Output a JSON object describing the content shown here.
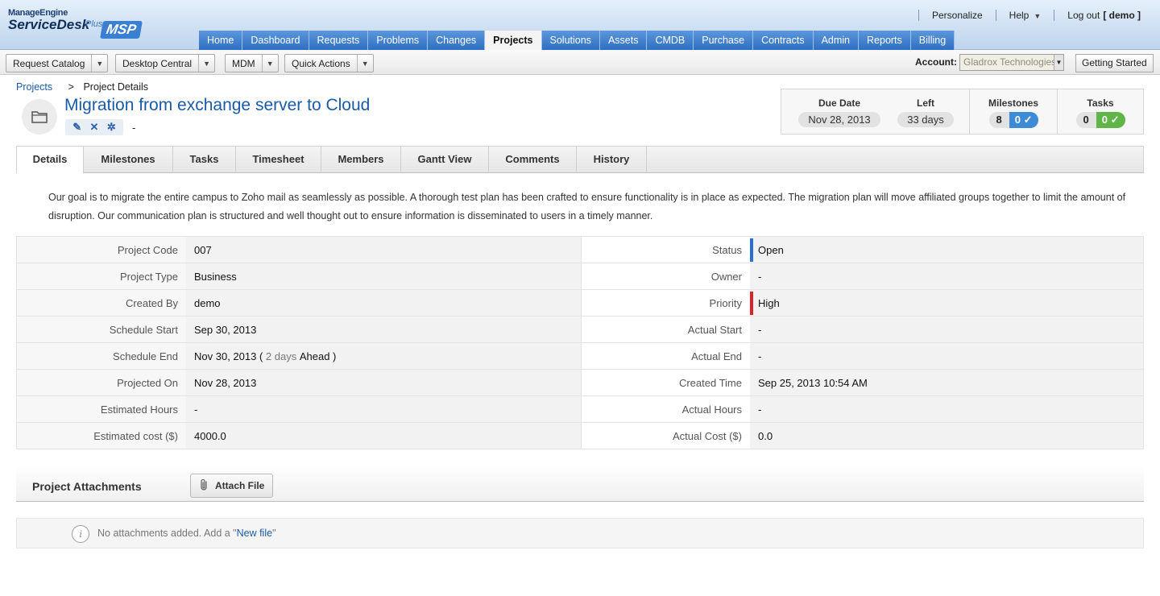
{
  "brand": {
    "line1": "ManageEngine",
    "line2": "ServiceDesk",
    "plus": "Plus",
    "msp": "MSP"
  },
  "toplinks": {
    "personalize": "Personalize",
    "help": "Help",
    "logout": "Log out",
    "user": "[ demo ]"
  },
  "nav": [
    "Home",
    "Dashboard",
    "Requests",
    "Problems",
    "Changes",
    "Projects",
    "Solutions",
    "Assets",
    "CMDB",
    "Purchase",
    "Contracts",
    "Admin",
    "Reports",
    "Billing"
  ],
  "nav_active": "Projects",
  "toolbar": {
    "request_catalog": "Request Catalog",
    "desktop_central": "Desktop Central",
    "mdm": "MDM",
    "quick_actions": "Quick Actions",
    "account_label": "Account:",
    "account_value": "Gladrox Technologies",
    "getting_started": "Getting Started"
  },
  "breadcrumb": {
    "root": "Projects",
    "sep": ">",
    "current": "Project Details"
  },
  "project": {
    "title": "Migration from exchange server to Cloud",
    "subline": "-"
  },
  "summary": {
    "due_label": "Due Date",
    "due_value": "Nov 28, 2013",
    "left_label": "Left",
    "left_value": "33 days",
    "milestones_label": "Milestones",
    "milestones_total": "8",
    "milestones_done": "0",
    "tasks_label": "Tasks",
    "tasks_total": "0",
    "tasks_done": "0",
    "colors": {
      "milestones_badge": "#3d8bd6",
      "tasks_badge": "#5fb548"
    }
  },
  "tabs": [
    "Details",
    "Milestones",
    "Tasks",
    "Timesheet",
    "Members",
    "Gantt View",
    "Comments",
    "History"
  ],
  "description": "Our goal is to migrate the entire campus to Zoho mail as seamlessly as possible. A thorough test plan has been crafted to ensure functionality is in place as expected. The migration plan will move affiliated groups together to limit the amount of disruption. Our communication plan is structured and well thought out to ensure information is disseminated to users in a timely manner.",
  "details": {
    "left": [
      {
        "label": "Project Code",
        "value": "007"
      },
      {
        "label": "Project Type",
        "value": "Business"
      },
      {
        "label": "Created By",
        "value": "demo"
      },
      {
        "label": "Schedule Start",
        "value": "Sep 30, 2013"
      },
      {
        "label": "Schedule End",
        "value": "Nov 30, 2013 (",
        "extra": "2 days",
        "extra2": "Ahead )"
      },
      {
        "label": "Projected On",
        "value": "Nov 28, 2013"
      },
      {
        "label": "Estimated Hours",
        "value": "-"
      },
      {
        "label": "Estimated cost ($)",
        "value": "4000.0"
      }
    ],
    "right": [
      {
        "label": "Status",
        "value": "Open"
      },
      {
        "label": "Owner",
        "value": "-"
      },
      {
        "label": "Priority",
        "value": "High"
      },
      {
        "label": "Actual Start",
        "value": "-"
      },
      {
        "label": "Actual End",
        "value": "-"
      },
      {
        "label": "Created Time",
        "value": "Sep 25, 2013 10:54 AM"
      },
      {
        "label": "Actual Hours",
        "value": "-"
      },
      {
        "label": "Actual Cost ($)",
        "value": "0.0"
      }
    ],
    "colors": {
      "status_bar": "#2a6fd6",
      "priority_bar": "#d9232b"
    }
  },
  "attachments": {
    "title": "Project Attachments",
    "button": "Attach File",
    "empty_msg": "No attachments added. Add a \"",
    "empty_link": "New file",
    "empty_end": "\""
  }
}
